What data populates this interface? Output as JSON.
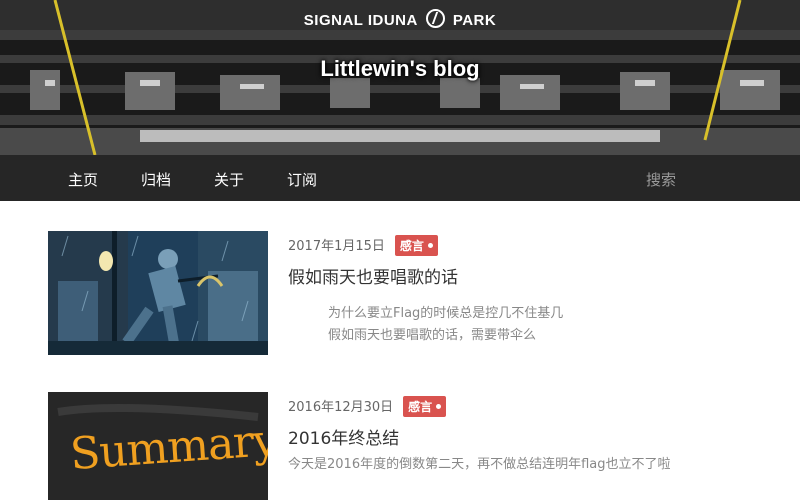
{
  "header": {
    "brand": {
      "left": "SIGNAL IDUNA",
      "right": "PARK",
      "logo_icon": "bvb-stadium-logo-icon"
    },
    "site_title": "Littlewin's blog"
  },
  "nav": {
    "items": [
      "主页",
      "归档",
      "关于",
      "订阅"
    ],
    "search_label": "搜索"
  },
  "posts": [
    {
      "date": "2017年1月15日",
      "tag": "感言",
      "title": "假如雨天也要唱歌的话",
      "excerpt": [
        "为什么要立Flag的时候总是控几不住基几",
        "假如雨天也要唱歌的话，需要带伞么"
      ],
      "thumbnail_icon": "singing-in-the-rain-image"
    },
    {
      "date": "2016年12月30日",
      "tag": "感言",
      "title": "2016年终总结",
      "excerpt": [
        "今天是2016年度的倒数第二天，再不做总结连明年flag也立不了啦"
      ],
      "thumbnail_text": "Summary"
    }
  ],
  "colors": {
    "tag_bg": "#d9534f",
    "nav_bg": "#262626",
    "thumb2_text": "#f0a020"
  }
}
